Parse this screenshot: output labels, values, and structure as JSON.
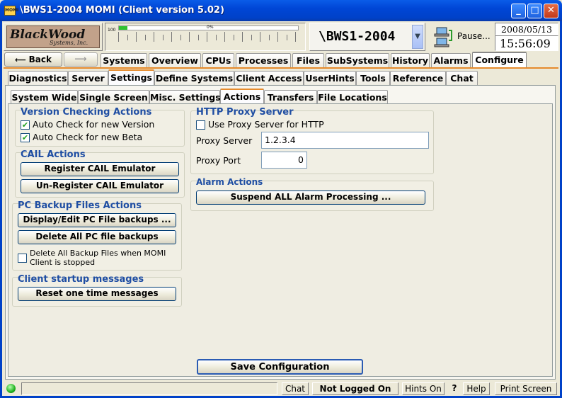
{
  "window": {
    "title": "\\BWS1-2004 MOMI (Client version 5.02)",
    "icon": "MOMI",
    "minimize": "_",
    "maximize": "□",
    "close": "✕"
  },
  "header": {
    "logo_line1": "BlackWood",
    "logo_line2": "Systems, Inc.",
    "gauge_max": "100",
    "gauge_label": "0%",
    "server": "\\BWS1-2004",
    "pause_label": "Pause...",
    "date": "2008/05/13",
    "time": "15:56:09"
  },
  "nav": {
    "back": "Back",
    "forward": "",
    "tabs": [
      "Systems",
      "Overview",
      "CPUs",
      "Processes",
      "Files",
      "SubSystems",
      "History",
      "Alarms",
      "Configure"
    ]
  },
  "configure_tabs": [
    "Diagnostics",
    "Server",
    "Settings",
    "Define Systems",
    "Client Access",
    "UserHints",
    "Tools",
    "Reference",
    "Chat"
  ],
  "settings_tabs": [
    "System Wide",
    "Single Screen",
    "Misc. Settings",
    "Actions",
    "Transfers",
    "File Locations"
  ],
  "version_checking": {
    "title": "Version Checking Actions",
    "items": [
      {
        "label": "Auto Check for new Version",
        "checked": "✔"
      },
      {
        "label": "Auto Check for new Beta",
        "checked": "✔"
      }
    ]
  },
  "cail": {
    "title": "CAIL Actions",
    "register": "Register CAIL Emulator",
    "unregister": "Un-Register CAIL Emulator"
  },
  "backup": {
    "title": "PC Backup Files Actions",
    "display": "Display/Edit PC File backups ...",
    "delete": "Delete All PC file backups",
    "delete_on_stop_line1": "Delete All Backup Files when MOMI",
    "delete_on_stop_line2": "Client is stopped"
  },
  "startup": {
    "title": "Client startup messages",
    "reset": "Reset one time messages"
  },
  "proxy": {
    "title": "HTTP Proxy Server",
    "use_label": "Use Proxy Server for HTTP",
    "server_label": "Proxy Server",
    "server_value": "1.2.3.4",
    "port_label": "Proxy Port",
    "port_value": "0"
  },
  "alarm": {
    "title": "Alarm Actions",
    "suspend": "Suspend ALL Alarm Processing ..."
  },
  "save": "Save Configuration",
  "status": {
    "chat": "Chat",
    "login": "Not Logged On",
    "hints": "Hints On",
    "help_q": "?",
    "help": "Help",
    "print": "Print Screen"
  },
  "colors": {
    "accent": "#e68b2c",
    "title_bar": "#0046d6",
    "heading": "#1f4ea3"
  }
}
